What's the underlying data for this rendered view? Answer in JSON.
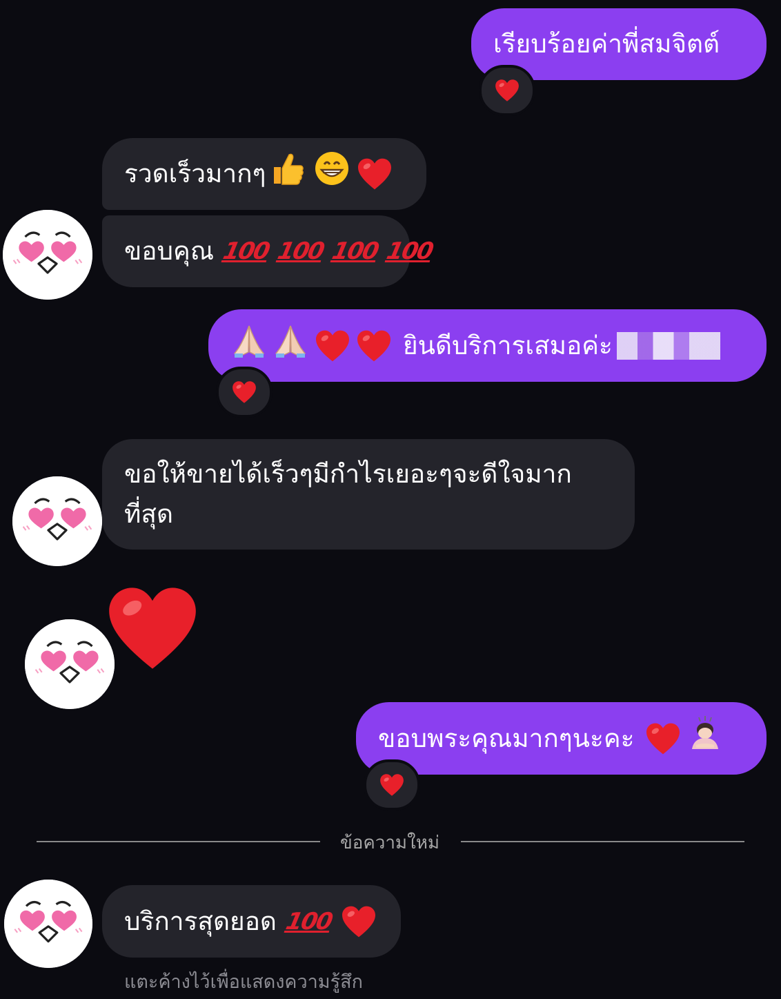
{
  "messages": [
    {
      "id": "m1",
      "direction": "outgoing",
      "text": "เรียบร้อยค่าพี่สมจิตต์",
      "reaction": "heart"
    },
    {
      "id": "m2",
      "direction": "incoming",
      "text": "รวดเร็วมากๆ",
      "emojis": [
        "thumbs-up",
        "grin",
        "heart"
      ]
    },
    {
      "id": "m3",
      "direction": "incoming",
      "text": "ขอบคุณ",
      "hundreds": [
        "💯",
        "💯",
        "💯",
        "💯"
      ]
    },
    {
      "id": "m4",
      "direction": "outgoing",
      "text": "ยินดีบริการเสมอค่ะ",
      "emojis_before": [
        "pray",
        "pray",
        "heart",
        "heart"
      ],
      "reaction": "heart"
    },
    {
      "id": "m5",
      "direction": "incoming",
      "line1": "ขอให้ขายได้เร็วๆมีกำไรเยอะๆจะดีใจมาก",
      "line2": "ที่สุด"
    },
    {
      "id": "m6",
      "direction": "incoming",
      "big_emoji": "heart"
    },
    {
      "id": "m7",
      "direction": "outgoing",
      "text": "ขอบพระคุณมากๆนะคะ",
      "emojis": [
        "heart",
        "bowing-woman"
      ],
      "reaction": "heart"
    },
    {
      "id": "m8",
      "direction": "incoming",
      "text": "บริการสุดยอด",
      "hundreds": [
        "💯"
      ],
      "emojis": [
        "heart"
      ]
    }
  ],
  "divider": {
    "label": "ข้อความใหม่"
  },
  "hint": {
    "label": "แตะค้างไว้เพื่อแสดงความรู้สึก"
  },
  "colors": {
    "background": "#0b0b11",
    "outgoing_bubble": "#8b3ff0",
    "incoming_bubble": "#24242b",
    "heart": "#e8202a"
  }
}
